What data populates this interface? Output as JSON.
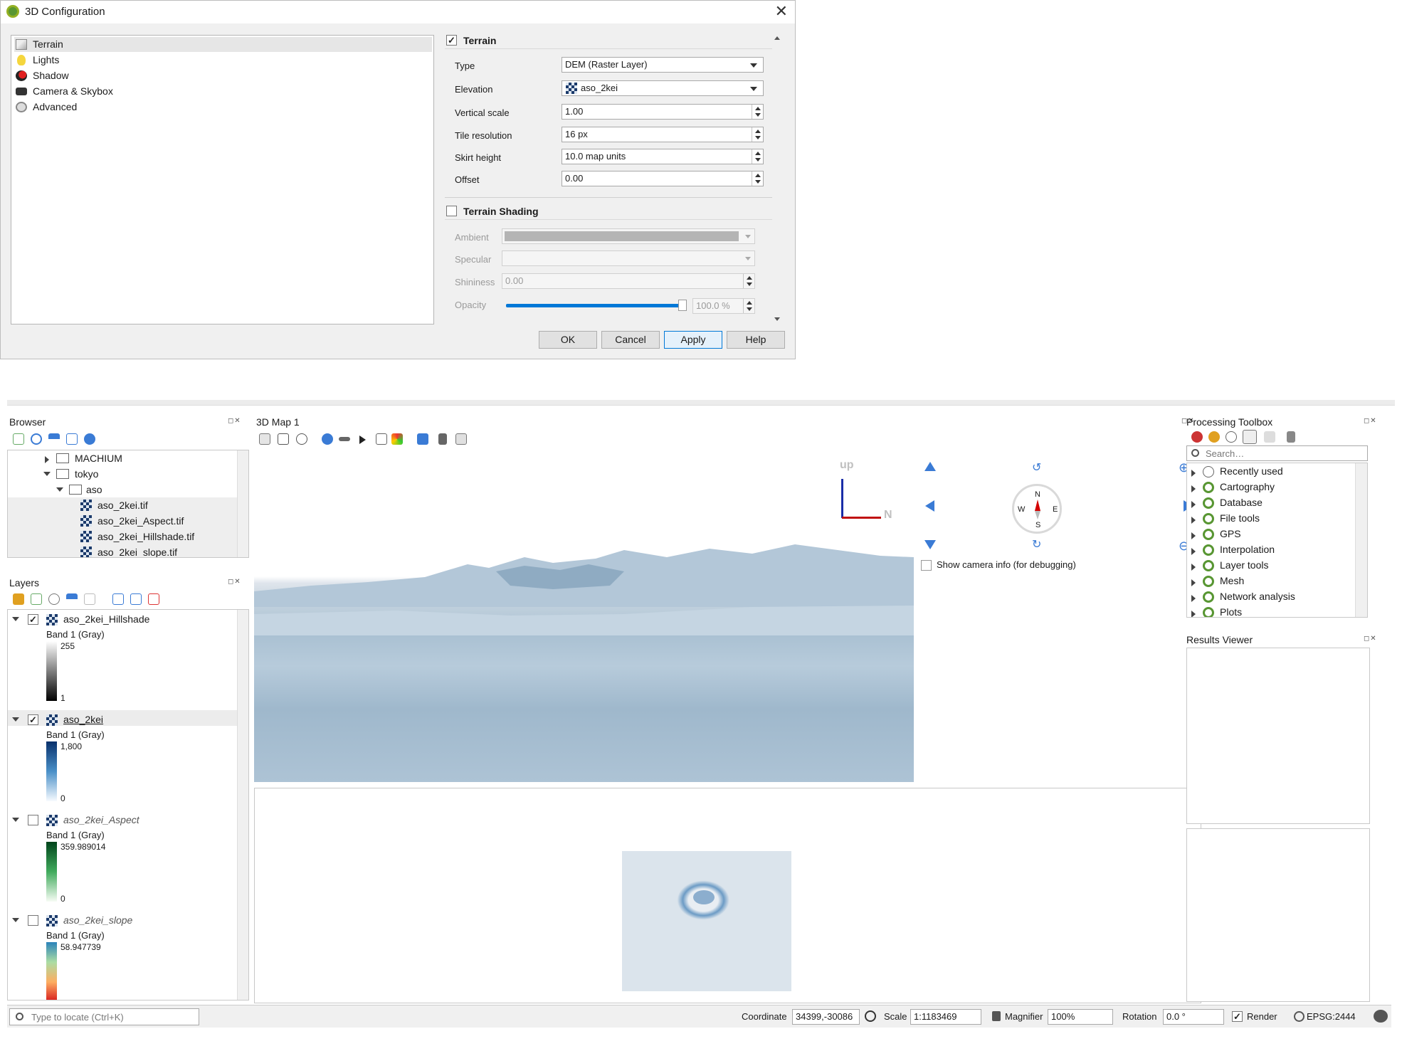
{
  "dialog": {
    "title": "3D Configuration",
    "close_glyph": "✕",
    "nav": [
      "Terrain",
      "Lights",
      "Shadow",
      "Camera & Skybox",
      "Advanced"
    ],
    "terrain": {
      "header": "Terrain",
      "checked_glyph": "✓",
      "type_label": "Type",
      "type_value": "DEM (Raster Layer)",
      "elevation_label": "Elevation",
      "elevation_value": "aso_2kei",
      "vscale_label": "Vertical scale",
      "vscale_value": "1.00",
      "tileres_label": "Tile resolution",
      "tileres_value": "16  px",
      "skirt_label": "Skirt height",
      "skirt_value": "10.0 map units",
      "offset_label": "Offset",
      "offset_value": "0.00"
    },
    "shading": {
      "header": "Terrain Shading",
      "ambient_label": "Ambient",
      "specular_label": "Specular",
      "shininess_label": "Shininess",
      "shininess_value": "0.00",
      "opacity_label": "Opacity",
      "opacity_value": "100.0 %"
    },
    "buttons": {
      "ok": "OK",
      "cancel": "Cancel",
      "apply": "Apply",
      "help": "Help"
    }
  },
  "browser": {
    "title": "Browser",
    "items": [
      "MACHIUM",
      "tokyo",
      "aso",
      "aso_2kei.tif",
      "aso_2kei_Aspect.tif",
      "aso_2kei_Hillshade.tif",
      "aso_2kei_slope.tif"
    ]
  },
  "layers": {
    "title": "Layers",
    "list": [
      {
        "name": "aso_2kei_Hillshade",
        "band": "Band 1 (Gray)",
        "max": "255",
        "min": "1"
      },
      {
        "name": "aso_2kei",
        "band": "Band 1 (Gray)",
        "max": "1,800",
        "min": "0"
      },
      {
        "name": "aso_2kei_Aspect",
        "band": "Band 1 (Gray)",
        "max": "359.989014",
        "min": "0"
      },
      {
        "name": "aso_2kei_slope",
        "band": "Band 1 (Gray)",
        "max": "58.947739",
        "min": ""
      }
    ]
  },
  "map3d": {
    "title": "3D Map 1",
    "axis_up": "up",
    "axis_n": "N",
    "compass": {
      "n": "N",
      "s": "S",
      "e": "E",
      "w": "W"
    },
    "camera_info_label": "Show camera info (for debugging)"
  },
  "toolbox": {
    "title": "Processing Toolbox",
    "search_placeholder": "Search…",
    "items": [
      "Recently used",
      "Cartography",
      "Database",
      "File tools",
      "GPS",
      "Interpolation",
      "Layer tools",
      "Mesh",
      "Network analysis",
      "Plots"
    ]
  },
  "results": {
    "title": "Results Viewer"
  },
  "status": {
    "locate_placeholder": "Type to locate (Ctrl+K)",
    "coord_label": "Coordinate",
    "coord_value": "34399,-30086",
    "scale_label": "Scale",
    "scale_value": "1:1183469",
    "magnifier_label": "Magnifier",
    "magnifier_value": "100%",
    "rotation_label": "Rotation",
    "rotation_value": "0.0 °",
    "render_label": "Render",
    "crs": "EPSG:2444"
  },
  "colors": {
    "accent": "#0078d7",
    "qgis_green": "#589632",
    "north_arrow": "#d40000"
  },
  "opacity_percent": 100
}
